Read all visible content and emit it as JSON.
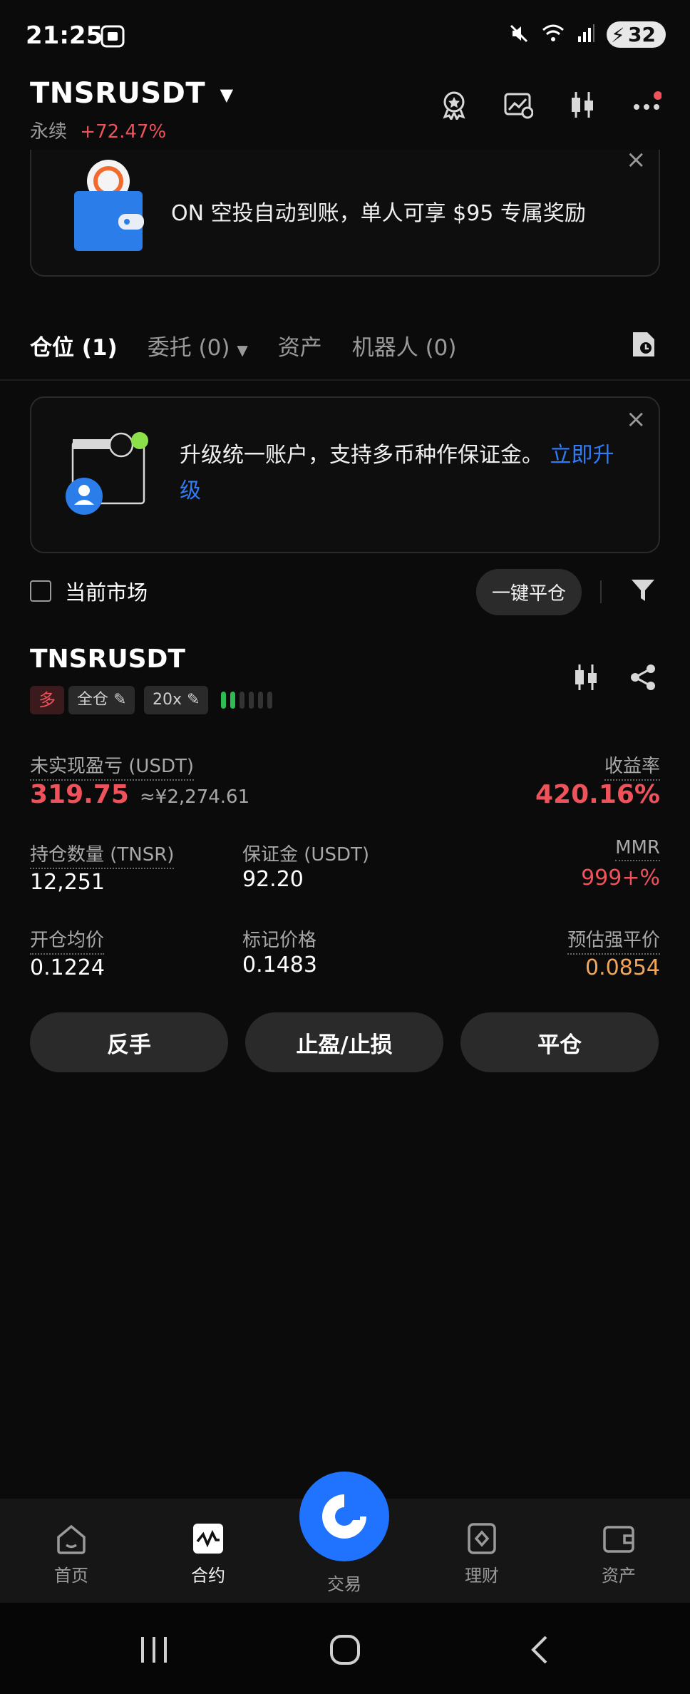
{
  "status_bar": {
    "time": "21:25",
    "battery": "32"
  },
  "header": {
    "pair": "TNSRUSDT",
    "type": "永续",
    "change": "+72.47%"
  },
  "promo_banner": {
    "text": "ON 空投自动到账，单人可享 $95 专属奖励",
    "close": "×"
  },
  "tabs": [
    {
      "label": "仓位 (1)"
    },
    {
      "label": "委托 (0)"
    },
    {
      "label": "资产"
    },
    {
      "label": "机器人 (0)"
    }
  ],
  "upgrade_banner": {
    "text": "升级统一账户，支持多币种作保证金。",
    "link": "立即升级",
    "close": "×"
  },
  "filter": {
    "current_market": "当前市场",
    "close_all": "一键平仓"
  },
  "position": {
    "symbol": "TNSRUSDT",
    "side": "多",
    "margin_mode": "全仓",
    "leverage": "20x",
    "risk_level": 2,
    "unrealized_pnl_label": "未实现盈亏 (USDT)",
    "unrealized_pnl": "319.75",
    "unrealized_pnl_cny": "≈¥2,274.61",
    "roe_label": "收益率",
    "roe": "420.16%",
    "size_label": "持仓数量 (TNSR)",
    "size": "12,251",
    "margin_label": "保证金 (USDT)",
    "margin": "92.20",
    "mmr_label": "MMR",
    "mmr": "999+%",
    "entry_label": "开仓均价",
    "entry": "0.1224",
    "mark_label": "标记价格",
    "mark": "0.1483",
    "liq_label": "预估强平价",
    "liq": "0.0854"
  },
  "actions": {
    "reverse": "反手",
    "tpsl": "止盈/止损",
    "close": "平仓"
  },
  "bottom_nav": {
    "home": "首页",
    "futures": "合约",
    "trade": "交易",
    "earn": "理财",
    "assets": "资产"
  },
  "colors": {
    "red": "#f0525b",
    "green": "#2ebd55",
    "blue": "#1f73ff",
    "orange": "#f2a65a"
  }
}
